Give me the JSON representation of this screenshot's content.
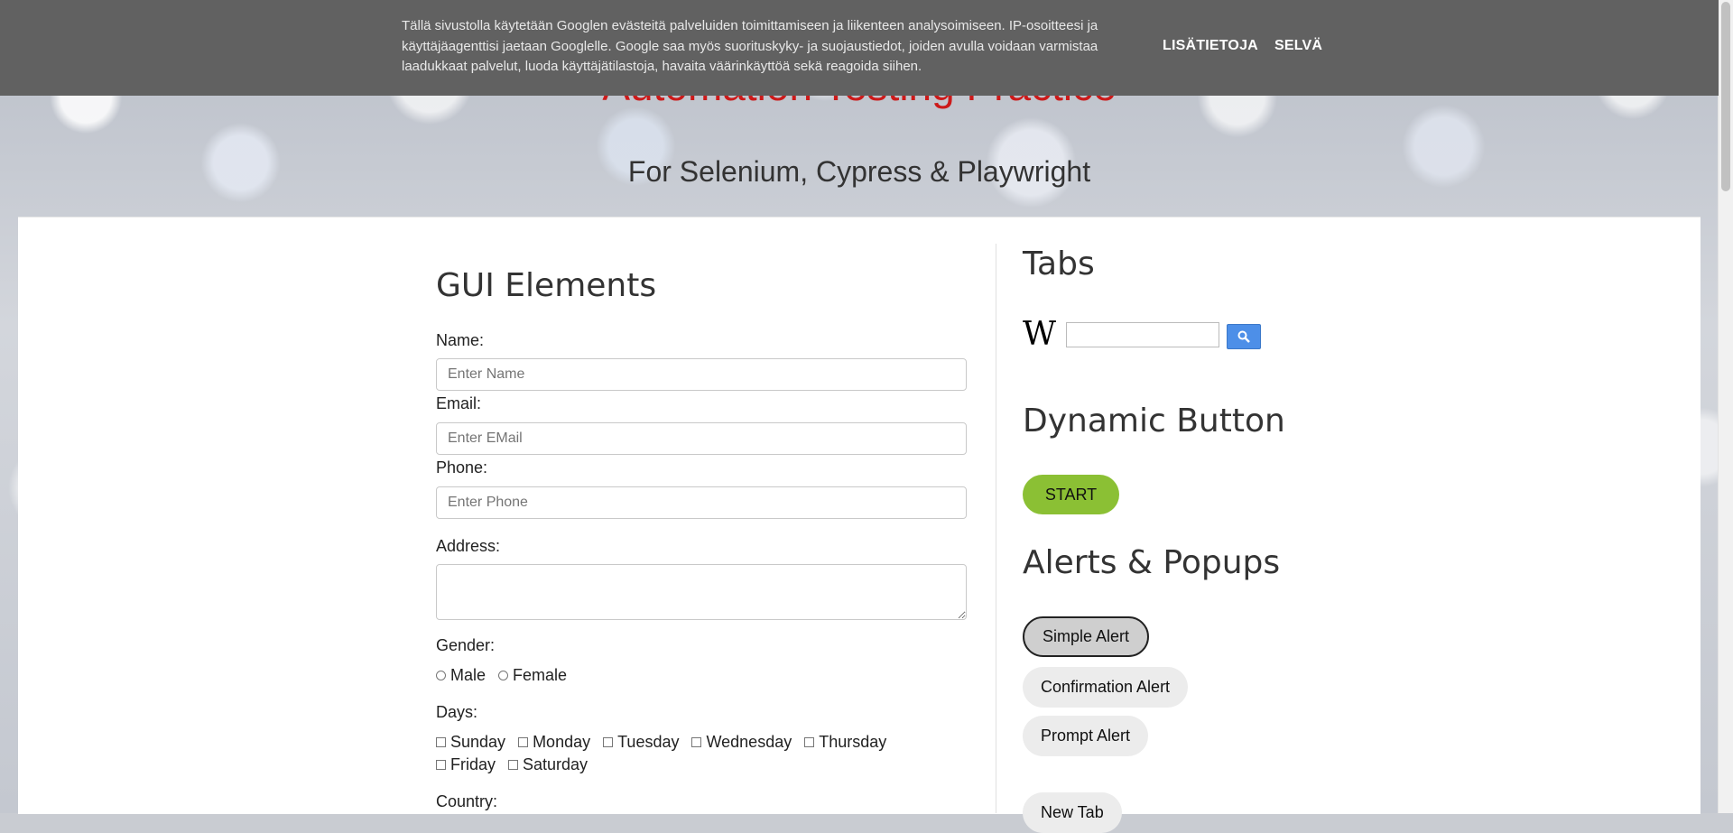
{
  "cookie": {
    "text": "Tällä sivustolla käytetään Googlen evästeitä palveluiden toimittamiseen ja liikenteen analysoimiseen. IP-osoitteesi ja käyttäjäagenttisi jaetaan Googlelle. Google saa myös suorituskyky- ja suojaustiedot, joiden avulla voidaan varmistaa laadukkaat palvelut, luoda käyttäjätilastoja, havaita väärinkäyttöä sekä reagoida siihen.",
    "more_label": "LISÄTIETOJA",
    "ok_label": "SELVÄ"
  },
  "header": {
    "title": "Automation Testing Practice",
    "subtitle": "For Selenium, Cypress & Playwright"
  },
  "form": {
    "title": "GUI Elements",
    "name_label": "Name:",
    "name_placeholder": "Enter Name",
    "email_label": "Email:",
    "email_placeholder": "Enter EMail",
    "phone_label": "Phone:",
    "phone_placeholder": "Enter Phone",
    "address_label": "Address:",
    "gender_label": "Gender:",
    "gender_options": [
      "Male",
      "Female"
    ],
    "days_label": "Days:",
    "days": [
      "Sunday",
      "Monday",
      "Tuesday",
      "Wednesday",
      "Thursday",
      "Friday",
      "Saturday"
    ],
    "country_label": "Country:"
  },
  "sidebar": {
    "tabs_title": "Tabs",
    "wiki_logo": "W",
    "dynamic_title": "Dynamic Button",
    "start_label": "START",
    "alerts_title": "Alerts & Popups",
    "simple_alert": "Simple Alert",
    "confirm_alert": "Confirmation Alert",
    "prompt_alert": "Prompt Alert",
    "new_tab": "New Tab"
  },
  "colors": {
    "title_red": "#cc1a1a",
    "gui_blue": "#0d3c9a",
    "start_green": "#8bc034",
    "cookie_bg": "#616161"
  }
}
